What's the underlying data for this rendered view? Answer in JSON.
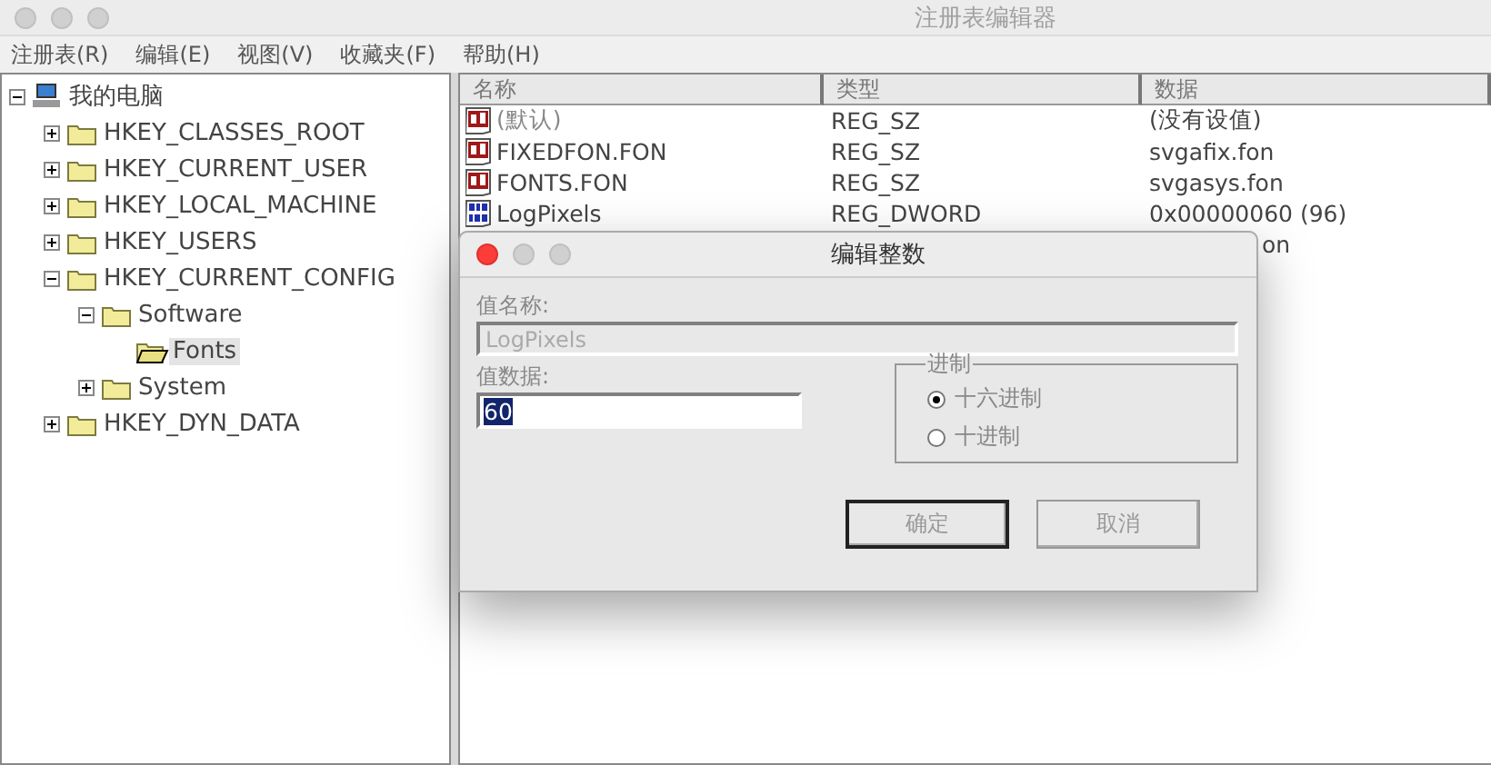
{
  "window": {
    "title": "注册表编辑器"
  },
  "menu": [
    "注册表(R)",
    "编辑(E)",
    "视图(V)",
    "收藏夹(F)",
    "帮助(H)"
  ],
  "tree": [
    {
      "label": "我的电脑",
      "kind": "computer",
      "expanded": true,
      "selected": false,
      "children": [
        {
          "label": "HKEY_CLASSES_ROOT",
          "kind": "folder",
          "expanded": false,
          "selected": false
        },
        {
          "label": "HKEY_CURRENT_USER",
          "kind": "folder",
          "expanded": false,
          "selected": false
        },
        {
          "label": "HKEY_LOCAL_MACHINE",
          "kind": "folder",
          "expanded": false,
          "selected": false
        },
        {
          "label": "HKEY_USERS",
          "kind": "folder",
          "expanded": false,
          "selected": false
        },
        {
          "label": "HKEY_CURRENT_CONFIG",
          "kind": "folder",
          "expanded": true,
          "selected": false,
          "children": [
            {
              "label": "Software",
              "kind": "folder",
              "expanded": true,
              "selected": false,
              "children": [
                {
                  "label": "Fonts",
                  "kind": "open-folder",
                  "selected": true
                }
              ]
            },
            {
              "label": "System",
              "kind": "folder",
              "expanded": false,
              "selected": false
            }
          ]
        },
        {
          "label": "HKEY_DYN_DATA",
          "kind": "folder",
          "expanded": false,
          "selected": false
        }
      ]
    }
  ],
  "list": {
    "columns": [
      "名称",
      "类型",
      "数据"
    ],
    "rows": [
      {
        "kind": "string",
        "name": "(默认)",
        "type": "REG_SZ",
        "data": "(没有设值)"
      },
      {
        "kind": "string",
        "name": "FIXEDFON.FON",
        "type": "REG_SZ",
        "data": "svgafix.fon"
      },
      {
        "kind": "string",
        "name": "FONTS.FON",
        "type": "REG_SZ",
        "data": "svgasys.fon"
      },
      {
        "kind": "binary",
        "name": "LogPixels",
        "type": "REG_DWORD",
        "data": "0x00000060 (96)"
      },
      {
        "kind": "hidden",
        "data": "on"
      }
    ]
  },
  "dialog": {
    "title": "编辑整数",
    "name_label": "值名称:",
    "name_value": "LogPixels",
    "data_label": "值数据:",
    "data_value": "60",
    "base_label": "进制",
    "bases": [
      {
        "label": "十六进制",
        "selected": true
      },
      {
        "label": "十进制",
        "selected": false
      }
    ],
    "buttons": [
      {
        "label": "确定",
        "default": true
      },
      {
        "label": "取消",
        "default": false
      }
    ]
  }
}
